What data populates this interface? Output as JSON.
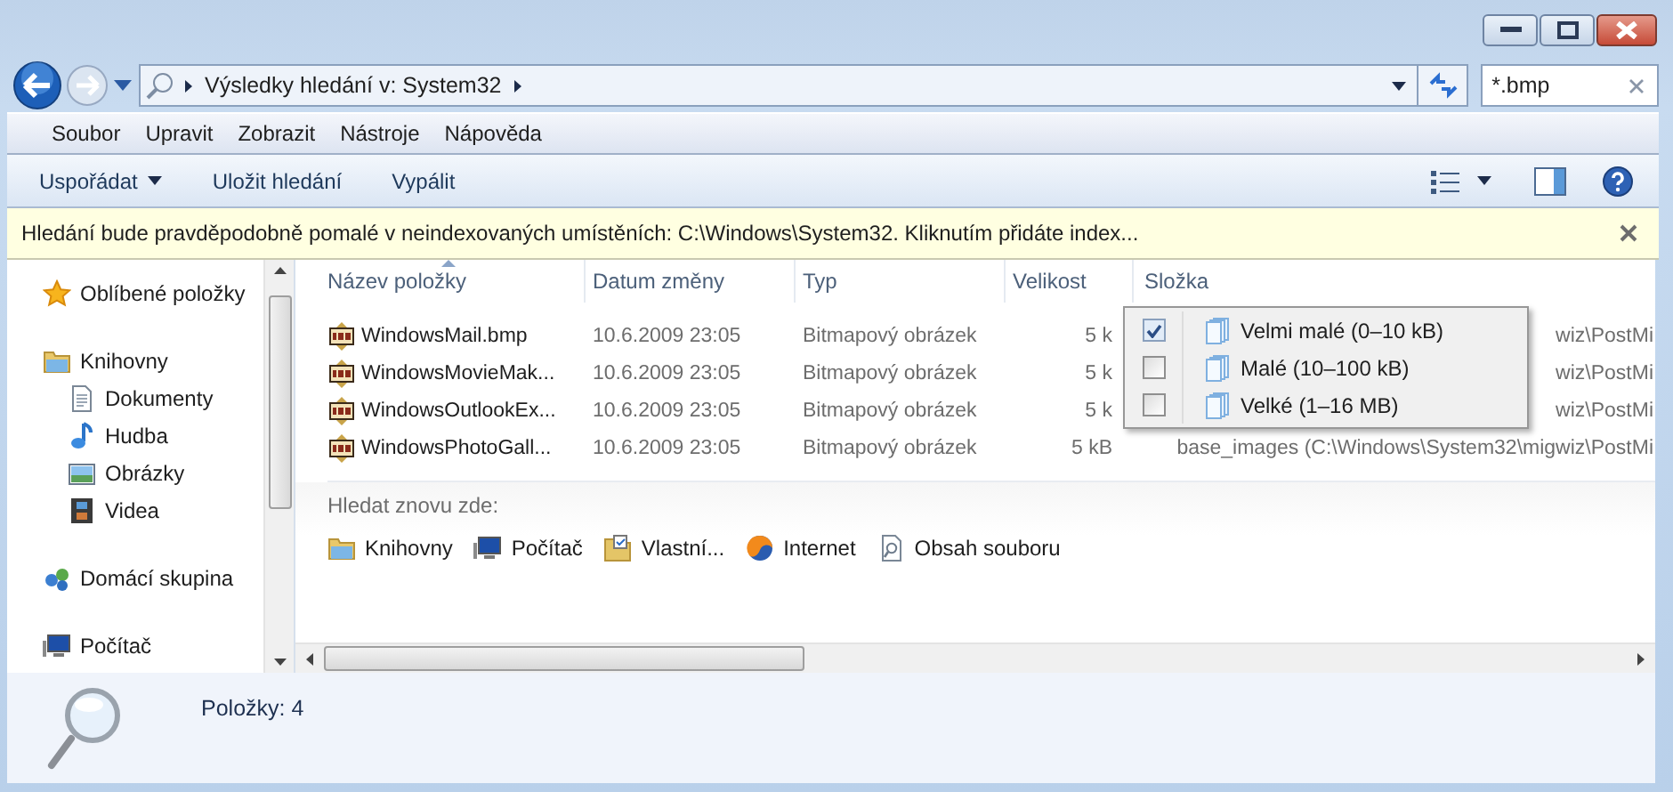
{
  "address_bar": {
    "path": [
      "Výsledky hledání v: System32"
    ]
  },
  "search": {
    "value": "*.bmp"
  },
  "menu": [
    "Soubor",
    "Upravit",
    "Zobrazit",
    "Nástroje",
    "Nápověda"
  ],
  "toolbar": [
    {
      "label": "Uspořádat",
      "dropdown": true
    },
    {
      "label": "Uložit hledání",
      "dropdown": false
    },
    {
      "label": "Vypálit",
      "dropdown": false
    }
  ],
  "info_bar": {
    "text": "Hledání bude pravděpodobně pomalé v neindexovaných umístěních: C:\\Windows\\System32. Kliknutím přidáte index..."
  },
  "nav": [
    {
      "label": "Oblíbené položky",
      "kind": "favorites"
    },
    {
      "label": "Knihovny",
      "kind": "libraries",
      "children": [
        {
          "label": "Dokumenty",
          "kind": "documents"
        },
        {
          "label": "Hudba",
          "kind": "music"
        },
        {
          "label": "Obrázky",
          "kind": "pictures"
        },
        {
          "label": "Videa",
          "kind": "videos"
        }
      ]
    },
    {
      "label": "Domácí skupina",
      "kind": "homegroup"
    },
    {
      "label": "Počítač",
      "kind": "computer"
    }
  ],
  "table": {
    "columns": [
      {
        "label": "Název položky",
        "sorted": true
      },
      {
        "label": "Datum změny",
        "sorted": false
      },
      {
        "label": "Typ",
        "sorted": false
      },
      {
        "label": "Velikost",
        "sorted": false
      },
      {
        "label": "Složka",
        "sorted": false
      }
    ],
    "rows": [
      {
        "cells": [
          "WindowsMail.bmp",
          "10.6.2009 23:05",
          "Bitmapový obrázek",
          "5 k",
          "wiz\\PostMi"
        ]
      },
      {
        "cells": [
          "WindowsMovieMak...",
          "10.6.2009 23:05",
          "Bitmapový obrázek",
          "5 k",
          "wiz\\PostMi"
        ]
      },
      {
        "cells": [
          "WindowsOutlookEx...",
          "10.6.2009 23:05",
          "Bitmapový obrázek",
          "5 k",
          "wiz\\PostMi"
        ]
      },
      {
        "cells": [
          "WindowsPhotoGall...",
          "10.6.2009 23:05",
          "Bitmapový obrázek",
          "5 kB",
          "base_images (C:\\Windows\\System32\\migwiz\\PostMi"
        ]
      }
    ]
  },
  "size_filter": {
    "options": [
      {
        "label": "Velmi malé (0–10 kB)",
        "checked": true
      },
      {
        "label": "Malé (10–100 kB)",
        "checked": false
      },
      {
        "label": "Velké (1–16 MB)",
        "checked": false
      }
    ]
  },
  "search_again": {
    "label": "Hledat znovu zde:",
    "items": [
      {
        "label": "Knihovny",
        "kind": "libraries"
      },
      {
        "label": "Počítač",
        "kind": "computer"
      },
      {
        "label": "Vlastní...",
        "kind": "custom"
      },
      {
        "label": "Internet",
        "kind": "internet"
      },
      {
        "label": "Obsah souboru",
        "kind": "contents"
      }
    ]
  },
  "status_bar": {
    "text": "Položky: 4"
  }
}
